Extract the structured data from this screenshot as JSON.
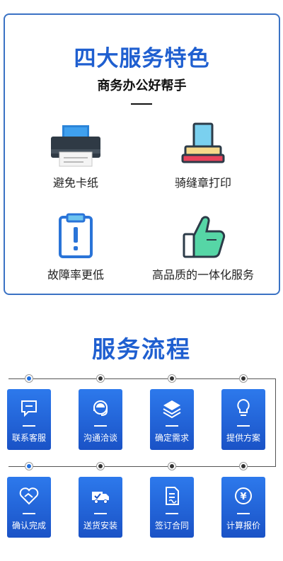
{
  "features": {
    "title": "四大服务特色",
    "subtitle": "商务办公好帮手",
    "items": [
      {
        "label": "避免卡纸",
        "icon": "printer-icon"
      },
      {
        "label": "骑缝章打印",
        "icon": "stamp-icon"
      },
      {
        "label": "故障率更低",
        "icon": "clipboard-alert-icon"
      },
      {
        "label": "高品质的一体化服务",
        "icon": "thumbs-up-icon"
      }
    ]
  },
  "process": {
    "title": "服务流程",
    "steps": [
      {
        "label": "联系客服",
        "icon": "chat-icon"
      },
      {
        "label": "沟通洽谈",
        "icon": "headset-icon"
      },
      {
        "label": "确定需求",
        "icon": "layers-icon"
      },
      {
        "label": "提供方案",
        "icon": "lightbulb-icon"
      },
      {
        "label": "确认完成",
        "icon": "handshake-icon"
      },
      {
        "label": "送货安装",
        "icon": "delivery-truck-icon"
      },
      {
        "label": "签订合同",
        "icon": "contract-icon"
      },
      {
        "label": "计算报价",
        "icon": "yen-icon"
      }
    ]
  },
  "colors": {
    "brand_blue": "#1f5fd0",
    "card_border": "#3a72c4",
    "step_gradient_top": "#2d79ec",
    "step_gradient_bottom": "#1a52c6"
  }
}
